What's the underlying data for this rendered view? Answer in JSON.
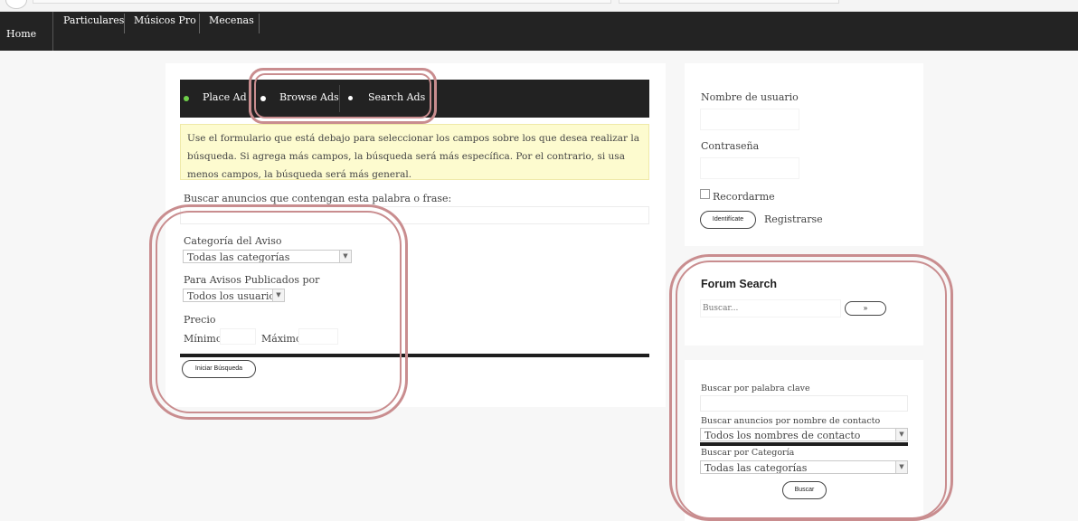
{
  "nav": {
    "home": "Home",
    "items": [
      "Particulares",
      "Músicos Pro",
      "Mecenas"
    ]
  },
  "ad_toolbar": {
    "place_ad": "Place Ad",
    "browse_ads": "Browse Ads",
    "search_ads": "Search Ads"
  },
  "search_form": {
    "notice": "Use el formulario que está debajo para seleccionar los campos sobre los que desea realizar la búsqueda. Si agrega más campos, la búsqueda será más específica. Por el contrario, si usa menos campos, la búsqueda será más general.",
    "keyword_label": "Buscar anuncios que contengan esta palabra o frase:",
    "category_label": "Categoría del Aviso",
    "category_value": "Todas las categorías",
    "posted_by_label": "Para Avisos Publicados por",
    "posted_by_value": "Todos los usuarios",
    "price_label": "Precio",
    "min_label": "Mínimo",
    "max_label": "Máximo",
    "submit": "Iniciar Búsqueda"
  },
  "login": {
    "username_label": "Nombre de usuario",
    "password_label": "Contraseña",
    "remember_label": "Recordarme",
    "login_button": "Identifícate",
    "register_link": "Registrarse"
  },
  "forum_search": {
    "title": "Forum Search",
    "placeholder": "Buscar...",
    "go_button": "»"
  },
  "sidebar_search": {
    "keyword_label": "Buscar por palabra clave",
    "contact_label": "Buscar anuncios por nombre de contacto",
    "contact_value": "Todos los nombres de contacto",
    "category_label": "Buscar por Categoría",
    "category_value": "Todas las categorías",
    "submit": "Buscar"
  },
  "colors": {
    "nav_bg": "#232323",
    "highlight": "#c98d8f",
    "notice_bg": "#fdfbcf",
    "place_ad_dot": "#6fcf4a"
  }
}
